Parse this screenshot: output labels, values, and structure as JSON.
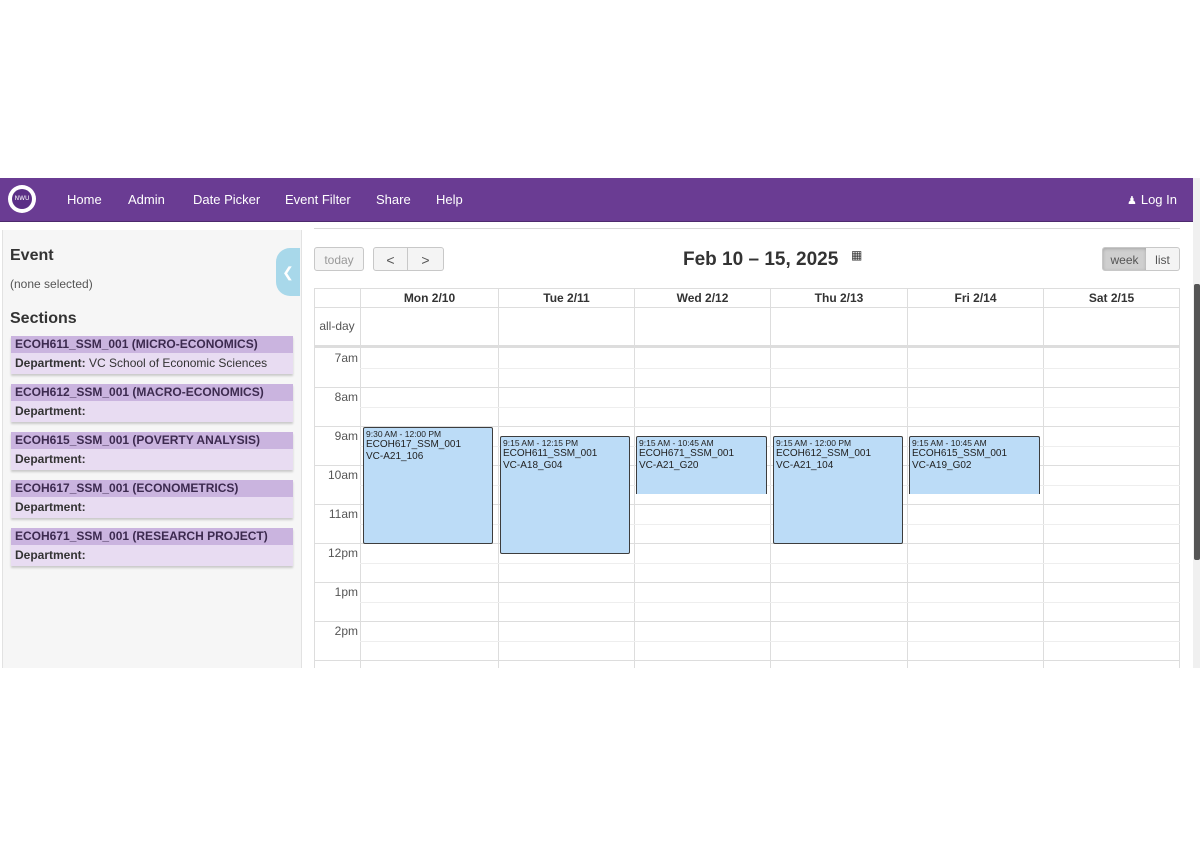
{
  "navbar": {
    "logo_text": "NWU",
    "items": [
      "Home",
      "Admin",
      "Date Picker",
      "Event Filter",
      "Share",
      "Help"
    ],
    "login_label": "Log In",
    "login_icon": "user-icon"
  },
  "sidebar": {
    "event_heading": "Event",
    "event_selected": "(none selected)",
    "sections_heading": "Sections",
    "department_label": "Department:",
    "sections": [
      {
        "title": "ECOH611_SSM_001 (MICRO-ECONOMICS)",
        "department": "VC School of Economic Sciences"
      },
      {
        "title": "ECOH612_SSM_001 (MACRO-ECONOMICS)",
        "department": ""
      },
      {
        "title": "ECOH615_SSM_001 (POVERTY ANALYSIS)",
        "department": ""
      },
      {
        "title": "ECOH617_SSM_001 (ECONOMETRICS)",
        "department": ""
      },
      {
        "title": "ECOH671_SSM_001 (RESEARCH PROJECT)",
        "department": ""
      }
    ],
    "collapse_icon": "chevron-left-icon"
  },
  "calendar": {
    "today_label": "today",
    "prev_label": "<",
    "next_label": ">",
    "title": "Feb 10 – 15, 2025",
    "title_icon": "calendar-icon",
    "view_week_label": "week",
    "view_list_label": "list",
    "active_view": "week",
    "days": [
      "Mon 2/10",
      "Tue 2/11",
      "Wed 2/12",
      "Thu 2/13",
      "Fri 2/14",
      "Sat 2/15"
    ],
    "allday_label": "all-day",
    "times": [
      "7am",
      "8am",
      "9am",
      "10am",
      "11am",
      "12pm",
      "1pm",
      "2pm"
    ],
    "events": [
      {
        "day": "Mon 2/10",
        "time": "9:30 AM - 12:00 PM",
        "course": "ECOH617_SSM_001",
        "venue": "VC-A21_106"
      },
      {
        "day": "Tue 2/11",
        "time": "9:15 AM - 12:15 PM",
        "course": "ECOH611_SSM_001",
        "venue": "VC-A18_G04"
      },
      {
        "day": "Wed 2/12",
        "time": "9:15 AM - 10:45 AM",
        "course": "ECOH671_SSM_001",
        "venue": "VC-A21_G20"
      },
      {
        "day": "Thu 2/13",
        "time": "9:15 AM - 12:00 PM",
        "course": "ECOH612_SSM_001",
        "venue": "VC-A21_104"
      },
      {
        "day": "Fri 2/14",
        "time": "9:15 AM - 10:45 AM",
        "course": "ECOH615_SSM_001",
        "venue": "VC-A19_G02"
      }
    ]
  }
}
